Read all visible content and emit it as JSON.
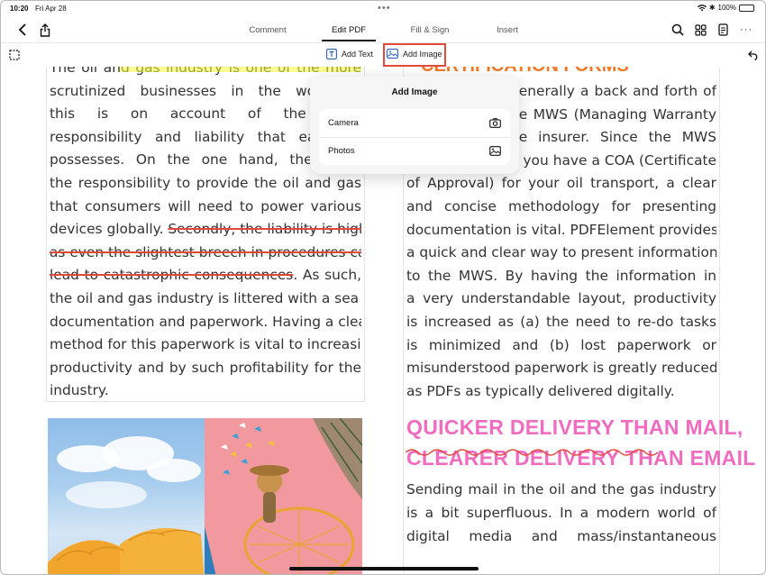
{
  "status": {
    "time": "10:20",
    "date": "Fri Apr 28",
    "battery": "100%"
  },
  "toolbar": {
    "tabs": [
      {
        "label": "Comment"
      },
      {
        "label": "Edit PDF"
      },
      {
        "label": "Fill & Sign"
      },
      {
        "label": "Insert"
      }
    ],
    "active_tab": "Edit PDF"
  },
  "subbar": {
    "add_text": "Add Text",
    "add_image": "Add Image"
  },
  "popover": {
    "title": "Add Image",
    "options": [
      {
        "label": "Camera",
        "icon": "camera-icon"
      },
      {
        "label": "Photos",
        "icon": "photos-icon"
      }
    ]
  },
  "document": {
    "left_lines": [
      "The oil and gas industry is one of the more",
      "scrutinized businesses in the world. P",
      "this is on account of the trem",
      "responsibility and liability that each co",
      "possesses. On the one hand, the busin",
      "the responsibility to provide the oil and gas",
      "that consumers will need to power various",
      "devices globally. ",
      "as even the slightest breech in procedures can",
      "lead to catastrophic consequences",
      "the oil and gas industry is littered with a sea of",
      "documentation and paperwork. Having a clear",
      "method for this paperwork is vital to increasing",
      "productivity and by such profitability for the",
      "industry."
    ],
    "left_strike_a": "Secondly, the liability is high",
    "left_after_strike": ". As such,",
    "right_heading": "CERTIFICATION FORMS",
    "right_lines": [
      "generally a back and forth of",
      "he MWS (Managing Warranty",
      "he insurer. Since the MWS",
      "will determine if you have a COA (Certificate",
      "of Approval) for your oil transport, a clear",
      "and concise methodology for presenting",
      "documentation is vital. PDFElement provides",
      "a quick and clear way to present information",
      "to the MWS. By having the information in",
      "a very understandable layout, productivity",
      "is increased as (a) the need to re-do tasks",
      "is minimized and (b) lost paperwork or",
      "misunderstood paperwork is greatly reduced",
      "as PDFs as typically delivered digitally."
    ],
    "pink_heading_1": "QUICKER DELIVERY THAN MAIL,",
    "pink_heading_2": "CLEARER DELIVERY THAN EMAIL",
    "right_lines_2": [
      "Sending mail in the oil and the gas industry",
      "is a bit superfluous. In a modern world of",
      "digital media and mass/instantaneous"
    ]
  },
  "colors": {
    "highlight": "#f6ff3b",
    "strike": "#e0483a",
    "heading_orange": "#f07a2a",
    "heading_pink": "#ef6cc0",
    "selection_box": "#e34c3c"
  }
}
